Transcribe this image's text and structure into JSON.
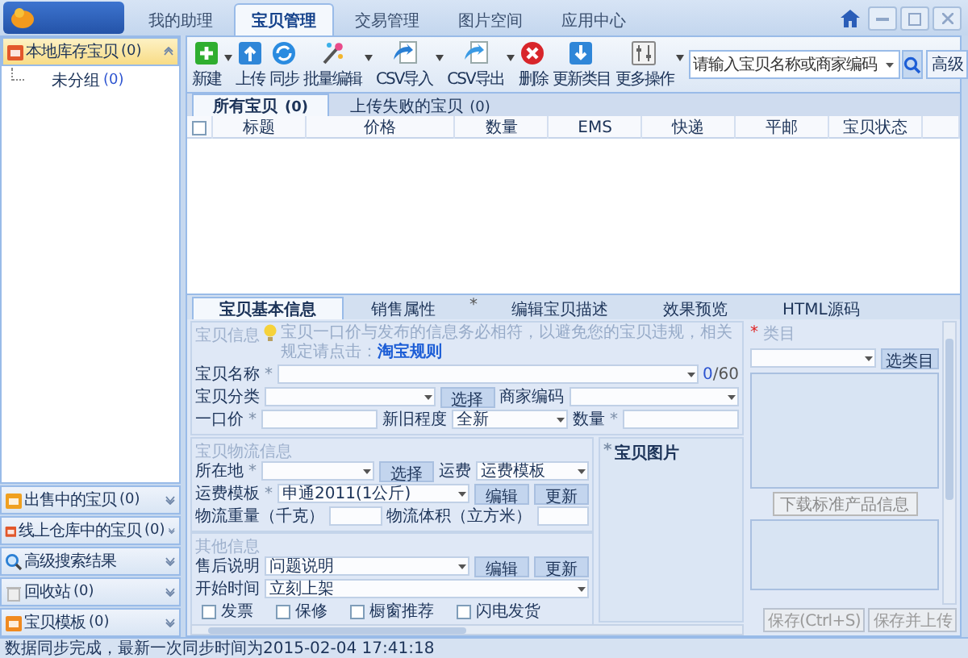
{
  "app_tabs": [
    {
      "label": "我的助理",
      "selected": false
    },
    {
      "label": "宝贝管理",
      "selected": true
    },
    {
      "label": "交易管理",
      "selected": false
    },
    {
      "label": "图片空间",
      "selected": false
    },
    {
      "label": "应用中心",
      "selected": false
    }
  ],
  "sidebar": {
    "top_group": {
      "label": "本地库存宝贝",
      "count": "(0)",
      "selected": true,
      "expanded": true,
      "children": [
        {
          "label": "未分组",
          "count": "(0)"
        }
      ]
    },
    "bottom_groups": [
      {
        "label": "出售中的宝贝",
        "count": "(0)",
        "selected": false,
        "expanded": false
      },
      {
        "label": "线上仓库中的宝贝",
        "count": "(0)",
        "selected": false,
        "expanded": false
      },
      {
        "label": "高级搜索结果",
        "selected": false,
        "expanded": false
      },
      {
        "label": "回收站",
        "count": "(0)",
        "selected": false,
        "expanded": false
      },
      {
        "label": "宝贝模板",
        "count": "(0)",
        "selected": false,
        "expanded": false
      }
    ]
  },
  "toolbar": {
    "buttons": [
      {
        "label": "新建",
        "menu": true
      },
      {
        "label": "上传",
        "menu": false
      },
      {
        "label": "同步",
        "menu": false
      },
      {
        "label": "批量编辑",
        "menu": true
      },
      {
        "label": "CSV导入",
        "menu": true
      },
      {
        "label": "CSV导出",
        "menu": true
      },
      {
        "label": "删除",
        "menu": false
      },
      {
        "label": "更新类目",
        "menu": false
      },
      {
        "label": "更多操作",
        "menu": true
      }
    ],
    "search": {
      "placeholder": "请输入宝贝名称或商家编码"
    },
    "advanced_button": "高级"
  },
  "item_tabs": [
    {
      "label": "所有宝贝",
      "count": "(0)",
      "selected": true
    },
    {
      "label": "上传失败的宝贝",
      "count": "(0)",
      "selected": false
    }
  ],
  "table": {
    "select_all_checked": false,
    "columns": [
      "标题",
      "价格",
      "数量",
      "EMS",
      "快递",
      "平邮",
      "宝贝状态"
    ]
  },
  "editor": {
    "tabs": [
      {
        "label": "宝贝基本信息",
        "selected": true
      },
      {
        "label": "销售属性",
        "selected": false,
        "mark": "*"
      },
      {
        "label": "编辑宝贝描述",
        "selected": false
      },
      {
        "label": "效果预览",
        "selected": false
      },
      {
        "label": "HTML源码",
        "selected": false
      }
    ],
    "basic": {
      "title": "宝贝信息",
      "hint": "宝贝一口价与发布的信息务必相符，以避免您的宝贝违规，相关规定请点击：",
      "link": "淘宝规则",
      "rows": [
        {
          "fields": [
            {
              "kind": "label",
              "text": "宝贝名称",
              "mark": "*"
            },
            {
              "kind": "select"
            },
            {
              "kind": "counter",
              "count": "0",
              "limit": "/60"
            }
          ]
        },
        {
          "fields": [
            {
              "kind": "label",
              "text": "宝贝分类"
            },
            {
              "kind": "select"
            },
            {
              "kind": "button",
              "text": "选择"
            },
            {
              "kind": "label",
              "text": "商家编码"
            },
            {
              "kind": "select"
            }
          ]
        },
        {
          "fields": [
            {
              "kind": "label",
              "text": "一口价",
              "mark": "*"
            },
            {
              "kind": "input"
            },
            {
              "kind": "label",
              "text": "新旧程度"
            },
            {
              "kind": "select",
              "value": "全新"
            },
            {
              "kind": "label",
              "text": "数量",
              "mark": "*"
            },
            {
              "kind": "input"
            }
          ]
        }
      ]
    },
    "logistics": {
      "title": "宝贝物流信息",
      "rows": [
        {
          "fields": [
            {
              "kind": "label",
              "text": "所在地",
              "mark": "*"
            },
            {
              "kind": "select"
            },
            {
              "kind": "button",
              "text": "选择"
            },
            {
              "kind": "label",
              "text": "运费"
            },
            {
              "kind": "select",
              "value": "运费模板"
            }
          ]
        },
        {
          "fields": [
            {
              "kind": "label",
              "text": "运费模板",
              "mark": "*"
            },
            {
              "kind": "select",
              "value": "申通2011(1公斤)"
            },
            {
              "kind": "button",
              "text": "编辑"
            },
            {
              "kind": "button",
              "text": "更新"
            }
          ]
        },
        {
          "fields": [
            {
              "kind": "label",
              "text": "物流重量（千克）"
            },
            {
              "kind": "input"
            },
            {
              "kind": "label",
              "text": "物流体积（立方米）"
            },
            {
              "kind": "input"
            }
          ]
        }
      ]
    },
    "other": {
      "title": "其他信息",
      "rows": [
        {
          "fields": [
            {
              "kind": "label",
              "text": "售后说明"
            },
            {
              "kind": "select",
              "value": "问题说明"
            },
            {
              "kind": "button",
              "text": "编辑"
            },
            {
              "kind": "button",
              "text": "更新"
            }
          ]
        },
        {
          "fields": [
            {
              "kind": "label",
              "text": "开始时间"
            },
            {
              "kind": "select",
              "value": "立刻上架"
            }
          ]
        }
      ],
      "checkboxes": [
        {
          "label": "发票",
          "checked": false
        },
        {
          "label": "保修",
          "checked": false
        },
        {
          "label": "橱窗推荐",
          "checked": false
        },
        {
          "label": "闪电发货",
          "checked": false
        }
      ]
    },
    "images": {
      "mark": "*",
      "title": "宝贝图片"
    },
    "category": {
      "mark": "*",
      "title": "类目",
      "button": "选类目",
      "download_button": "下载标准产品信息"
    },
    "save_buttons": [
      {
        "label": "保存(Ctrl+S)",
        "disabled": true
      },
      {
        "label": "保存并上传",
        "disabled": true
      }
    ]
  },
  "status_bar": "数据同步完成，最新一次同步时间为2015-02-04 17:41:18"
}
